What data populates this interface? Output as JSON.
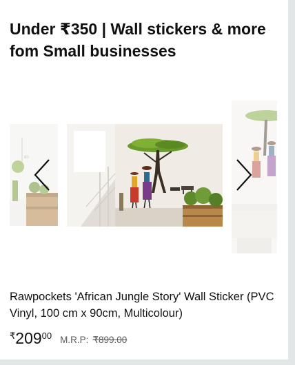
{
  "card": {
    "title": "Under ₹350 | Wall stickers & more fom Small businesses"
  },
  "carousel": {
    "prev_icon": "chevron-left-icon",
    "next_icon": "chevron-right-icon"
  },
  "product": {
    "name": "Rawpockets 'African Jungle Story' Wall Sticker (PVC Vinyl, 100 cm x 90cm, Multicolour)",
    "price_symbol": "₹",
    "price_whole": "209",
    "price_fraction": "00",
    "mrp_label": "M.R.P:",
    "mrp_value": "₹899.00"
  },
  "colors": {
    "text": "#0f1111",
    "muted": "#565959",
    "tree_green": "#6a9a2a",
    "floor": "#b8874a"
  }
}
